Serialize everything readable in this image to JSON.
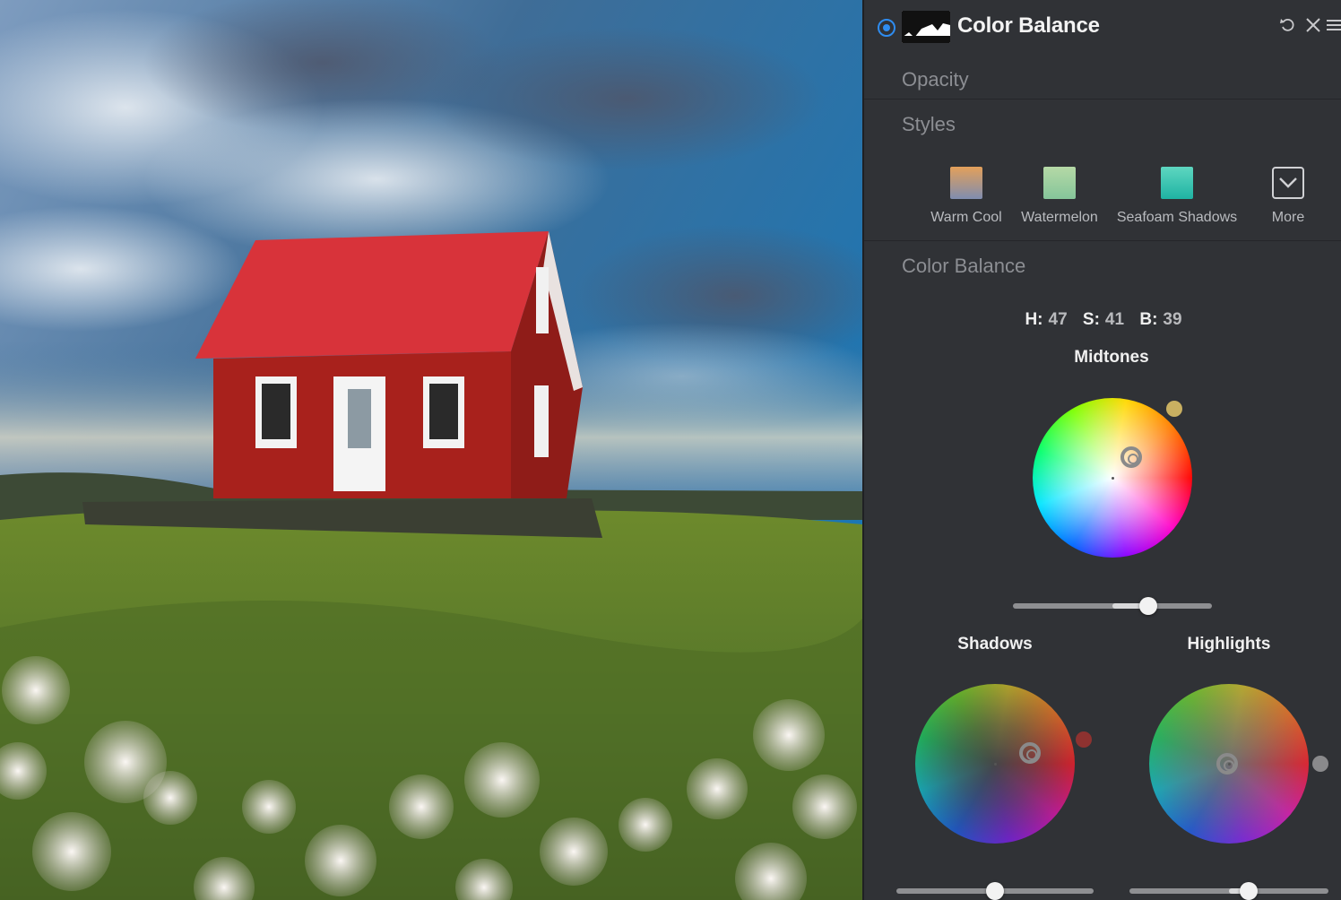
{
  "layer": {
    "title": "Color Balance",
    "visible": true
  },
  "sections": {
    "opacity_label": "Opacity",
    "styles_label": "Styles",
    "color_balance_label": "Color Balance"
  },
  "styles": [
    {
      "label": "Warm Cool",
      "color_top": "#e3a05a",
      "color_bottom": "#7f8db0"
    },
    {
      "label": "Watermelon",
      "color_top": "#a8d4a0",
      "color_bottom": "#8ec79a"
    },
    {
      "label": "Seafoam Shadows",
      "color_top": "#5ed6c0",
      "color_bottom": "#1fb3a3"
    },
    {
      "label": "More"
    }
  ],
  "hsb": {
    "h_label": "H:",
    "h_value": "47",
    "s_label": "S:",
    "s_value": "41",
    "b_label": "B:",
    "b_value": "39"
  },
  "wheels": {
    "midtones": {
      "label": "Midtones",
      "swatch": "#c9b061",
      "slider_value": 0.68
    },
    "shadows": {
      "label": "Shadows",
      "swatch": "#8e3230",
      "slider_value": 0.5
    },
    "highlights": {
      "label": "Highlights",
      "swatch": "#8a8a8c",
      "slider_value": 0.6
    }
  },
  "colors": {
    "accent": "#2e8cf0",
    "panel_bg": "#303236"
  }
}
